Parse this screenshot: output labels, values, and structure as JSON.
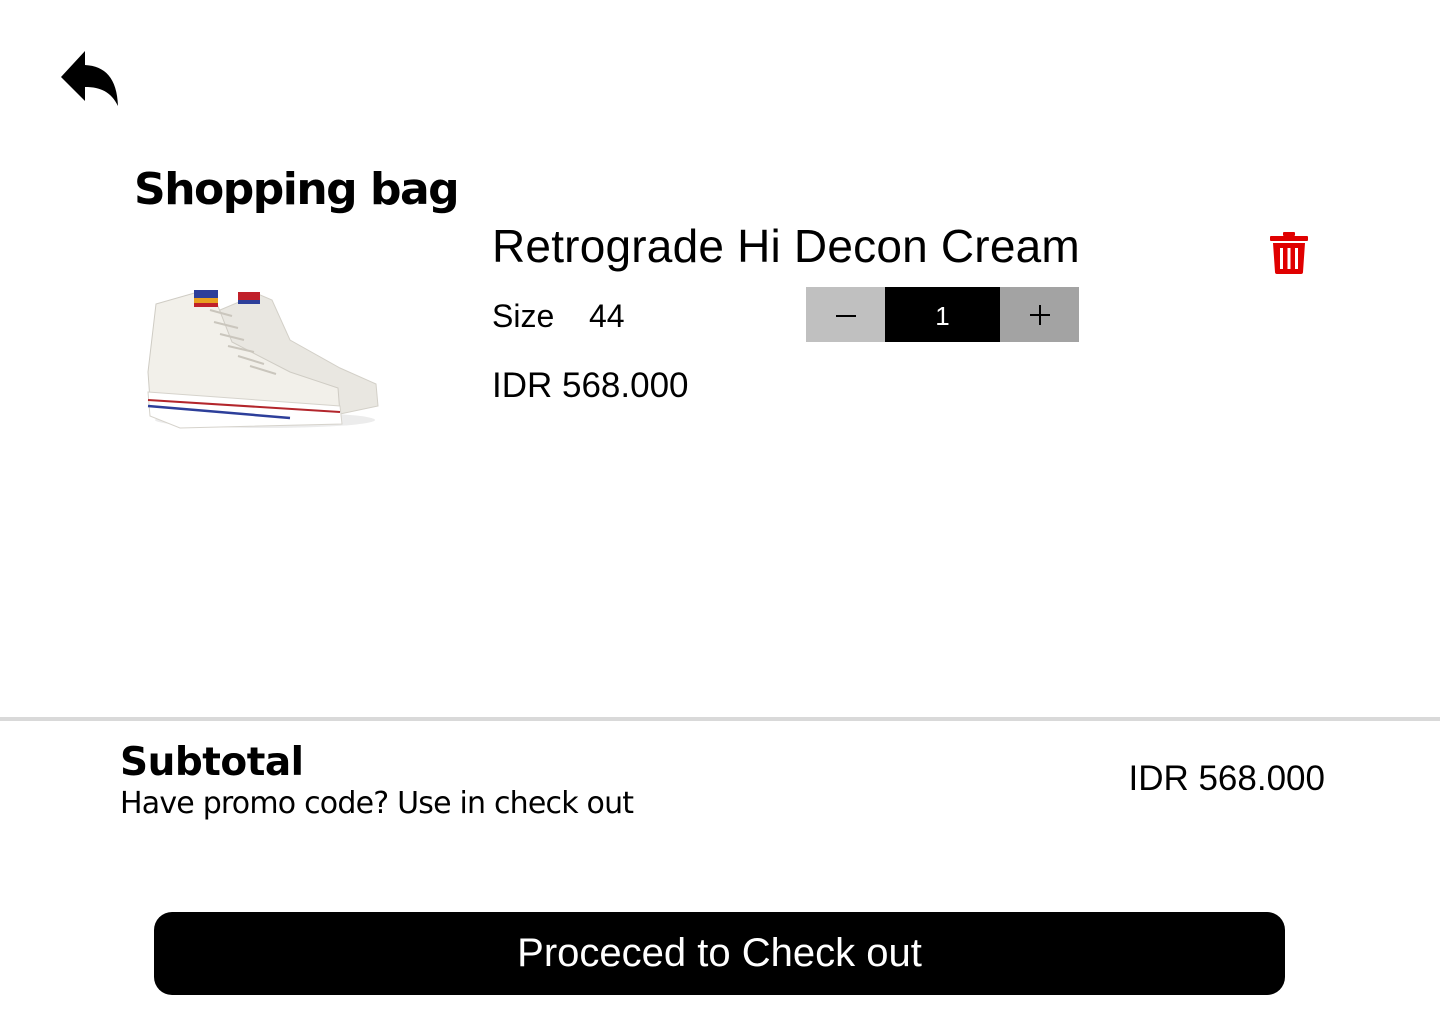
{
  "header": {
    "back_icon": "reply-arrow-icon",
    "title": "Shopping bag"
  },
  "cart": {
    "items": [
      {
        "name": "Retrograde Hi Decon Cream",
        "size_label": "Size",
        "size_value": "44",
        "quantity": "1",
        "price": "IDR 568.000",
        "image_icon": "sneaker-product-image",
        "delete_icon": "trash-icon"
      }
    ]
  },
  "summary": {
    "subtotal_label": "Subtotal",
    "promo_text": "Have promo code? Use in check out",
    "subtotal_value": "IDR 568.000"
  },
  "checkout": {
    "button_label": "Proceced to Check out"
  },
  "colors": {
    "delete": "#e00000",
    "primary": "#000000",
    "divider": "#d9d9d9",
    "qty_minus_bg": "#c0c0c0",
    "qty_plus_bg": "#a3a3a3"
  }
}
